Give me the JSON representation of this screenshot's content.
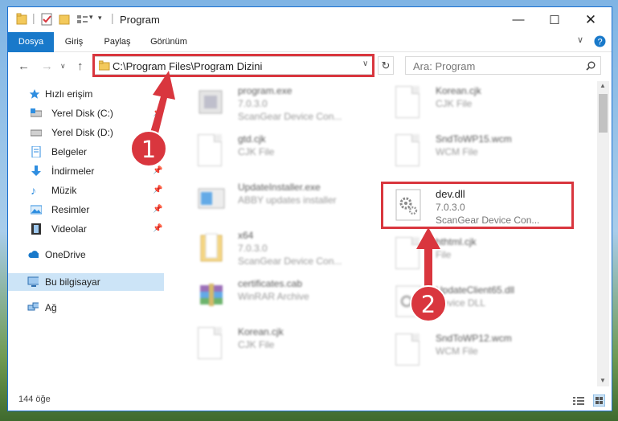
{
  "window": {
    "title": "Program"
  },
  "ribbon": {
    "tabs": [
      "Dosya",
      "Giriş",
      "Paylaş",
      "Görünüm"
    ]
  },
  "address": {
    "path": "C:\\Program Files\\Program Dizini"
  },
  "search": {
    "placeholder": "Ara: Program"
  },
  "sidebar": {
    "quick_access": "Hızlı erişim",
    "items": [
      "Yerel Disk (C:)",
      "Yerel Disk (D:)",
      "Belgeler",
      "İndirmeler",
      "Müzik",
      "Resimler",
      "Videolar"
    ],
    "onedrive": "OneDrive",
    "this_pc": "Bu bilgisayar",
    "network": "Ağ"
  },
  "files": [
    {
      "name": "program.exe",
      "line2": "7.0.3.0",
      "line3": "ScanGear Device Con...",
      "icon": "app-icon"
    },
    {
      "name": "Korean.cjk",
      "line2": "CJK File",
      "line3": "",
      "icon": "document-icon"
    },
    {
      "name": "gtd.cjk",
      "line2": "CJK File",
      "line3": "",
      "icon": "document-icon"
    },
    {
      "name": "SndToWP15.wcm",
      "line2": "WCM File",
      "line3": "",
      "icon": "document-icon"
    },
    {
      "name": "UpdateInstaller.exe",
      "line2": "ABBY updates installer",
      "line3": "",
      "icon": "installer-icon"
    },
    {
      "name": "dev.dll",
      "line2": "7.0.3.0",
      "line3": "ScanGear Device Con...",
      "icon": "gear-dll-icon"
    },
    {
      "name": "x64",
      "line2": "7.0.3.0",
      "line3": "ScanGear Device Con...",
      "icon": "folder-icon"
    },
    {
      "name": "hthtml.cjk",
      "line2": "File",
      "line3": "",
      "icon": "document-icon"
    },
    {
      "name": "certificates.cab",
      "line2": "WinRAR Archive",
      "line3": "",
      "icon": "archive-icon"
    },
    {
      "name": "UpdateClient65.dll",
      "line2": "Device DLL",
      "line3": "",
      "icon": "gear-dll-icon"
    },
    {
      "name": "Korean.cjk",
      "line2": "CJK File",
      "line3": "",
      "icon": "document-icon"
    },
    {
      "name": "SndToWP12.wcm",
      "line2": "WCM File",
      "line3": "",
      "icon": "document-icon"
    }
  ],
  "status": {
    "item_count": "144 öğe"
  },
  "annotations": {
    "step1": "1",
    "step2": "2"
  },
  "colors": {
    "accent": "#1979ca",
    "annotation": "#d9363e",
    "selection": "#cce4f7"
  }
}
